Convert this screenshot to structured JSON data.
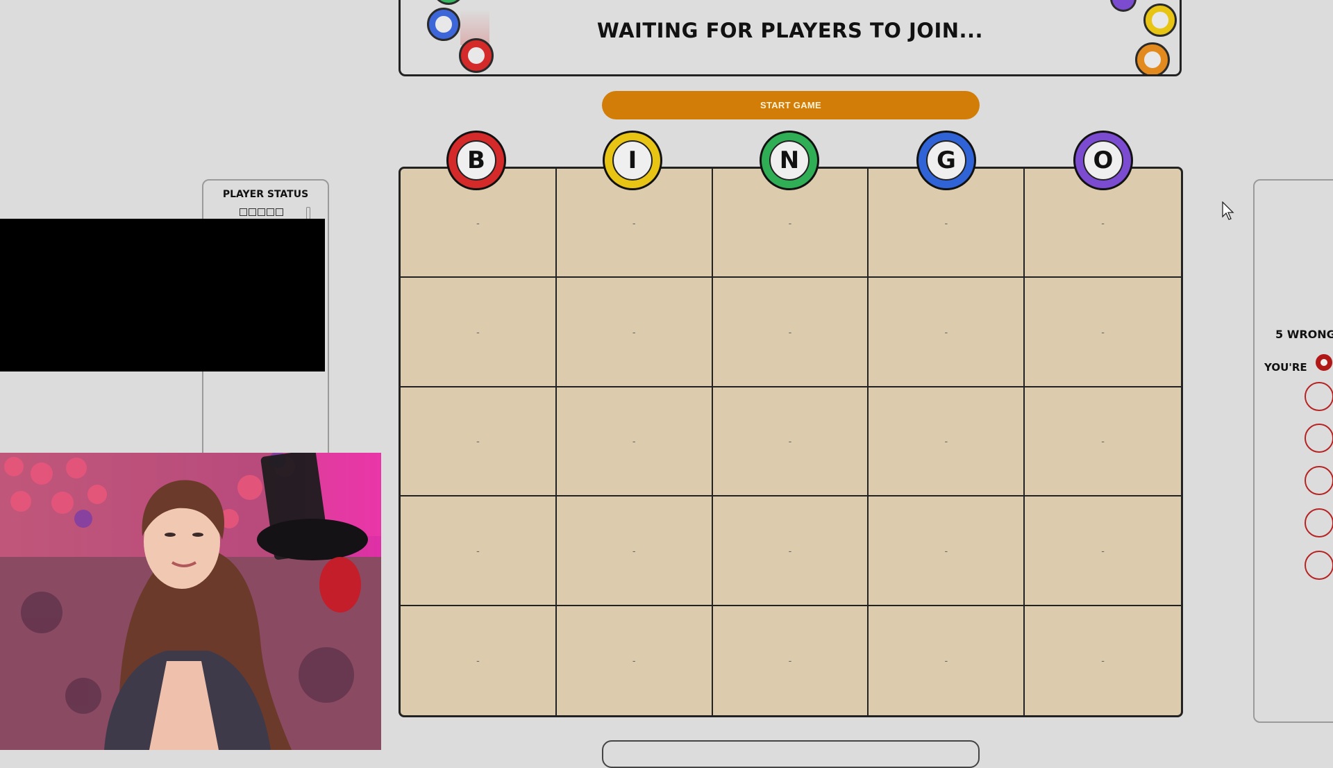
{
  "banner": {
    "title": "WAITING FOR PLAYERS TO JOIN..."
  },
  "controls": {
    "start_label": "START GAME"
  },
  "columns": [
    {
      "letter": "B",
      "color": "#d42a2a"
    },
    {
      "letter": "I",
      "color": "#e8c415"
    },
    {
      "letter": "N",
      "color": "#2fae55"
    },
    {
      "letter": "G",
      "color": "#2f63d6"
    },
    {
      "letter": "O",
      "color": "#7b4bd0"
    }
  ],
  "board": {
    "cells": [
      [
        "-",
        "-",
        "-",
        "-",
        "-"
      ],
      [
        "-",
        "-",
        "-",
        "-",
        "-"
      ],
      [
        "-",
        "-",
        "-",
        "-",
        "-"
      ],
      [
        "-",
        "-",
        "-",
        "-",
        "-"
      ],
      [
        "-",
        "-",
        "-",
        "-",
        "-"
      ]
    ],
    "background": "#dccbad"
  },
  "player_status": {
    "title": "PLAYER STATUS",
    "mini_boxes": 5
  },
  "right_panel": {
    "wrong_text": "5 WRONG",
    "youre_text": "YOU'RE",
    "strike_count": 5,
    "strike_color": "#b52323"
  },
  "accent": {
    "start_button": "#d17d07"
  }
}
